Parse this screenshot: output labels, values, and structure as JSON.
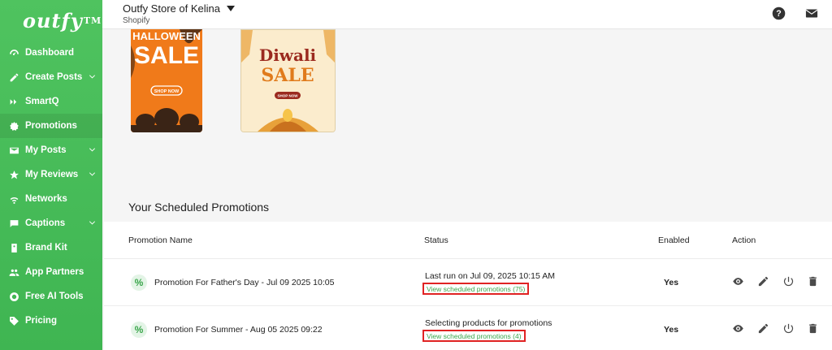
{
  "brand": {
    "logo_text": "outfy",
    "logo_mark": "TM"
  },
  "sidebar": {
    "items": [
      {
        "label": "Dashboard",
        "icon": "dashboard-icon",
        "expandable": false
      },
      {
        "label": "Create Posts",
        "icon": "pencil-icon",
        "expandable": true
      },
      {
        "label": "SmartQ",
        "icon": "smartq-icon",
        "expandable": false
      },
      {
        "label": "Promotions",
        "icon": "promotions-icon",
        "expandable": false,
        "active": true
      },
      {
        "label": "My Posts",
        "icon": "envelope-icon",
        "expandable": true
      },
      {
        "label": "My Reviews",
        "icon": "star-icon",
        "expandable": true
      },
      {
        "label": "Networks",
        "icon": "wifi-icon",
        "expandable": false
      },
      {
        "label": "Captions",
        "icon": "chat-icon",
        "expandable": true
      },
      {
        "label": "Brand Kit",
        "icon": "brandkit-icon",
        "expandable": false
      },
      {
        "label": "App Partners",
        "icon": "people-icon",
        "expandable": false
      },
      {
        "label": "Free AI Tools",
        "icon": "ai-tools-icon",
        "expandable": false
      },
      {
        "label": "Pricing",
        "icon": "tag-icon",
        "expandable": false
      }
    ]
  },
  "header": {
    "store_name": "Outfy Store of Kelina",
    "platform": "Shopify"
  },
  "promotions": {
    "section_title": "Your Scheduled Promotions",
    "columns": [
      "Promotion Name",
      "Status",
      "Enabled",
      "Action"
    ],
    "rows": [
      {
        "name": "Promotion For Father's Day - Jul 09 2025 10:05",
        "status": "Last run on Jul 09, 2025 10:15 AM",
        "link": "View scheduled promotions (75)",
        "enabled": "Yes"
      },
      {
        "name": "Promotion For Summer - Aug 05 2025 09:22",
        "status": "Selecting products for promotions",
        "link": "View scheduled promotions (4)",
        "enabled": "Yes"
      }
    ]
  },
  "thumbnails": [
    {
      "line1": "HALLOWEEN",
      "line2": "SALE",
      "button": "SHOP NOW"
    },
    {
      "line1": "Diwali",
      "line2": "SALE",
      "button": "SHOP NOW"
    }
  ],
  "colors": {
    "brand_green": "#43b955",
    "link_green": "#3aa64b",
    "highlight_red": "#e02323"
  }
}
